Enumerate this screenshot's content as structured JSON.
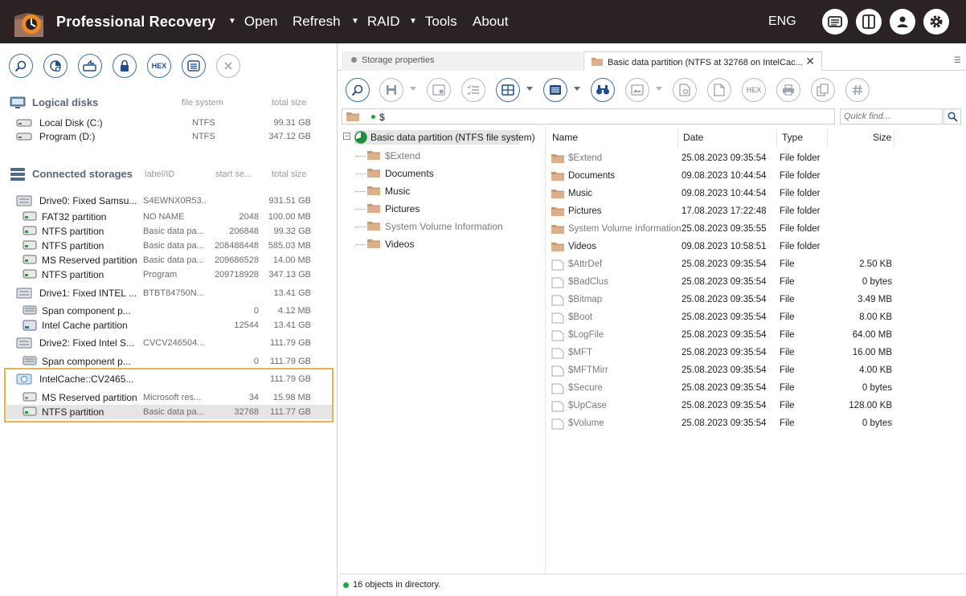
{
  "app": {
    "title": "Professional Recovery",
    "menu": [
      {
        "label": "Open",
        "has_arrow": true
      },
      {
        "label": "Refresh",
        "has_arrow": false
      },
      {
        "label": "RAID",
        "has_arrow": true
      },
      {
        "label": "Tools",
        "has_arrow": true
      },
      {
        "label": "About",
        "has_arrow": false
      }
    ],
    "language": "ENG",
    "top_icons": [
      "log-icon",
      "panels-icon",
      "user-icon",
      "settings-gear-icon"
    ],
    "accent_color": "#e8b24a",
    "topbar_color": "#2b2323"
  },
  "left_toolbar": {
    "buttons": [
      "search-icon",
      "scan-icon",
      "open-image-icon",
      "lock-icon",
      "hex-icon",
      "list-icon",
      "close-icon"
    ],
    "hex_label": "HEX"
  },
  "logical_disks": {
    "title": "Logical disks",
    "col_fs": "file system",
    "col_size": "total size",
    "items": [
      {
        "name": "Local Disk (C:)",
        "fs": "NTFS",
        "size": "99.31 GB"
      },
      {
        "name": "Program (D:)",
        "fs": "NTFS",
        "size": "347.12 GB"
      }
    ]
  },
  "connected_storages": {
    "title": "Connected storages",
    "col_label": "label/ID",
    "col_start": "start se...",
    "col_size": "total size",
    "rows": [
      {
        "name": "Drive0: Fixed Samsu...",
        "label": "S4EWNX0R53...",
        "start": "",
        "size": "931.51 GB",
        "kind": "drive"
      },
      {
        "name": "FAT32 partition",
        "label": "NO NAME",
        "start": "2048",
        "size": "100.00 MB",
        "kind": "part"
      },
      {
        "name": "NTFS partition",
        "label": "Basic data pa...",
        "start": "206848",
        "size": "99.32 GB",
        "kind": "part"
      },
      {
        "name": "NTFS partition",
        "label": "Basic data pa...",
        "start": "208488448",
        "size": "585.03 MB",
        "kind": "part"
      },
      {
        "name": "MS Reserved partition",
        "label": "Basic data pa...",
        "start": "209686528",
        "size": "14.00 MB",
        "kind": "part"
      },
      {
        "name": "NTFS partition",
        "label": "Program",
        "start": "209718928",
        "size": "347.13 GB",
        "kind": "part"
      },
      {
        "name": "Drive1: Fixed INTEL ...",
        "label": "BTBT84750N...",
        "start": "",
        "size": "13.41 GB",
        "kind": "drive"
      },
      {
        "name": "Span component p...",
        "label": "",
        "start": "0",
        "size": "4.12 MB",
        "kind": "span"
      },
      {
        "name": "Intel Cache partition",
        "label": "",
        "start": "12544",
        "size": "13.41 GB",
        "kind": "cache"
      },
      {
        "name": "Drive2: Fixed Intel S...",
        "label": "CVCV246504...",
        "start": "",
        "size": "111.79 GB",
        "kind": "drive"
      },
      {
        "name": "Span component p...",
        "label": "",
        "start": "0",
        "size": "111.79 GB",
        "kind": "span"
      },
      {
        "name": "IntelCache::CV2465...",
        "label": "",
        "start": "",
        "size": "111.79 GB",
        "kind": "virtual"
      },
      {
        "name": "MS Reserved partition",
        "label": "Microsoft res...",
        "start": "34",
        "size": "15.98 MB",
        "kind": "part-gray"
      },
      {
        "name": "NTFS partition",
        "label": "Basic data pa...",
        "start": "32768",
        "size": "111.77 GB",
        "kind": "part",
        "selected": true
      }
    ]
  },
  "tabs": {
    "tab1": "Storage properties",
    "tab2": "Basic data partition (NTFS at 32768 on IntelCac..."
  },
  "right_toolbar": {
    "buttons": [
      "search-icon",
      "save-icon",
      "save-disk-icon",
      "checklist-icon",
      "view-icon",
      "list-view-icon",
      "find-binoculars-icon",
      "preview-icon",
      "scan-file-icon",
      "file-icon",
      "hex-icon",
      "print-icon",
      "copy-icon",
      "hash-icon"
    ],
    "hex_label": "HEX"
  },
  "path": {
    "value": "$",
    "search_placeholder": "Quick find..."
  },
  "tree": {
    "root": "Basic data partition (NTFS file system)",
    "items": [
      {
        "label": "$Extend",
        "system": true
      },
      {
        "label": "Documents",
        "system": false
      },
      {
        "label": "Music",
        "system": false
      },
      {
        "label": "Pictures",
        "system": false
      },
      {
        "label": "System Volume Information",
        "system": true
      },
      {
        "label": "Videos",
        "system": false
      }
    ]
  },
  "file_list": {
    "headers": {
      "name": "Name",
      "date": "Date",
      "type": "Type",
      "size": "Size"
    },
    "rows": [
      {
        "name": "$Extend",
        "date": "25.08.2023 09:35:54",
        "type": "File folder",
        "size": "",
        "folder": true,
        "system": true
      },
      {
        "name": "Documents",
        "date": "09.08.2023 10:44:54",
        "type": "File folder",
        "size": "",
        "folder": true,
        "system": false
      },
      {
        "name": "Music",
        "date": "09.08.2023 10:44:54",
        "type": "File folder",
        "size": "",
        "folder": true,
        "system": false
      },
      {
        "name": "Pictures",
        "date": "17.08.2023 17:22:48",
        "type": "File folder",
        "size": "",
        "folder": true,
        "system": false
      },
      {
        "name": "System Volume Information",
        "date": "25.08.2023 09:35:55",
        "type": "File folder",
        "size": "",
        "folder": true,
        "system": true
      },
      {
        "name": "Videos",
        "date": "09.08.2023 10:58:51",
        "type": "File folder",
        "size": "",
        "folder": true,
        "system": false
      },
      {
        "name": "$AttrDef",
        "date": "25.08.2023 09:35:54",
        "type": "File",
        "size": "2.50 KB",
        "folder": false,
        "system": true
      },
      {
        "name": "$BadClus",
        "date": "25.08.2023 09:35:54",
        "type": "File",
        "size": "0 bytes",
        "folder": false,
        "system": true
      },
      {
        "name": "$Bitmap",
        "date": "25.08.2023 09:35:54",
        "type": "File",
        "size": "3.49 MB",
        "folder": false,
        "system": true
      },
      {
        "name": "$Boot",
        "date": "25.08.2023 09:35:54",
        "type": "File",
        "size": "8.00 KB",
        "folder": false,
        "system": true
      },
      {
        "name": "$LogFile",
        "date": "25.08.2023 09:35:54",
        "type": "File",
        "size": "64.00 MB",
        "folder": false,
        "system": true
      },
      {
        "name": "$MFT",
        "date": "25.08.2023 09:35:54",
        "type": "File",
        "size": "16.00 MB",
        "folder": false,
        "system": true
      },
      {
        "name": "$MFTMirr",
        "date": "25.08.2023 09:35:54",
        "type": "File",
        "size": "4.00 KB",
        "folder": false,
        "system": true
      },
      {
        "name": "$Secure",
        "date": "25.08.2023 09:35:54",
        "type": "File",
        "size": "0 bytes",
        "folder": false,
        "system": true
      },
      {
        "name": "$UpCase",
        "date": "25.08.2023 09:35:54",
        "type": "File",
        "size": "128.00 KB",
        "folder": false,
        "system": true
      },
      {
        "name": "$Volume",
        "date": "25.08.2023 09:35:54",
        "type": "File",
        "size": "0 bytes",
        "folder": false,
        "system": true
      }
    ]
  },
  "status": {
    "text": "16 objects in directory."
  }
}
